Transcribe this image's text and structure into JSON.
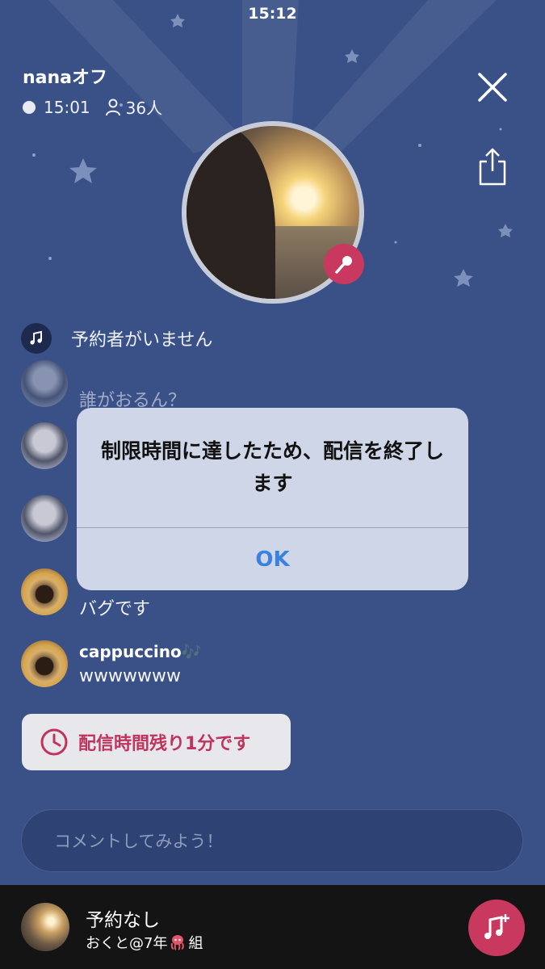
{
  "status_bar": {
    "time": "15:12"
  },
  "room": {
    "title": "nanaオフ",
    "elapsed": "15:01",
    "listeners": "36人"
  },
  "reservation": {
    "text": "予約者がいません"
  },
  "comments": [
    {
      "name": "",
      "text": "誰がおるん？"
    },
    {
      "name": "",
      "text": ""
    },
    {
      "name": "",
      "text": ""
    },
    {
      "name": "",
      "text": "バグです"
    },
    {
      "name": "cappuccino🎶",
      "text": "wwwwwww"
    }
  ],
  "timer_notice": {
    "text": "配信時間残り1分です"
  },
  "comment_input": {
    "placeholder": "コメントしてみよう！"
  },
  "now_playing": {
    "title": "予約なし",
    "user_prefix": "おくと@7年",
    "user_suffix": "組"
  },
  "alert": {
    "message": "制限時間に達したため、配信を終了します",
    "ok_label": "OK"
  },
  "colors": {
    "background": "#3a5188",
    "accent": "#c8385f",
    "alert_button": "#3b82e0"
  },
  "icons": [
    "close-icon",
    "share-icon",
    "microphone-icon",
    "music-note-icon",
    "clock-icon",
    "person-icon",
    "music-add-icon"
  ]
}
